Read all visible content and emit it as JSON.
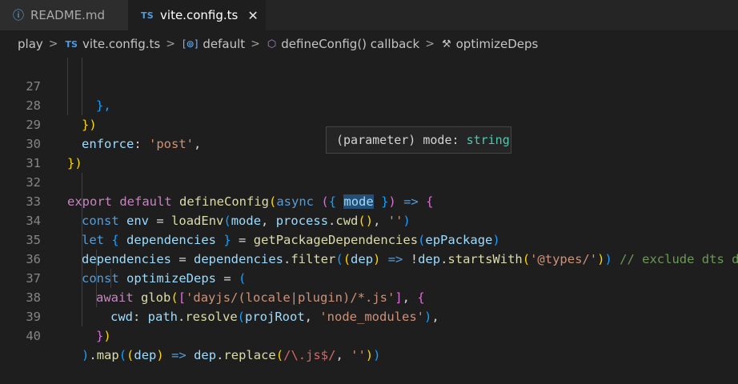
{
  "tabs": [
    {
      "label": "README.md",
      "icon": "info-icon",
      "active": false
    },
    {
      "label": "vite.config.ts",
      "icon": "typescript-icon",
      "icon_text": "TS",
      "active": true,
      "close_glyph": "✕"
    }
  ],
  "breadcrumb": {
    "items": [
      {
        "label": "play",
        "icon": ""
      },
      {
        "label": "vite.config.ts",
        "icon": "typescript-icon",
        "icon_text": "TS"
      },
      {
        "label": "default",
        "icon": "variable-icon",
        "icon_text": "[⊚]"
      },
      {
        "label": "defineConfig() callback",
        "icon": "method-cube-icon",
        "icon_text": "⬡"
      },
      {
        "label": "optimizeDeps",
        "icon": "wrench-icon",
        "icon_text": "🔧"
      }
    ],
    "separator": ">"
  },
  "hover": {
    "prefix": "(parameter) mode: ",
    "type": "string"
  },
  "lines": [
    {
      "n": "27"
    },
    {
      "n": "28"
    },
    {
      "n": "29"
    },
    {
      "n": "30"
    },
    {
      "n": "31"
    },
    {
      "n": "32"
    },
    {
      "n": "33"
    },
    {
      "n": "34"
    },
    {
      "n": "35"
    },
    {
      "n": "36"
    },
    {
      "n": "37"
    },
    {
      "n": "38"
    },
    {
      "n": "39"
    },
    {
      "n": "40"
    }
  ],
  "code": {
    "l27": [
      "},",
      ","
    ],
    "l28": [
      "})",
      ","
    ],
    "l29": {
      "key": "enforce",
      "colon": ": ",
      "val": "'post'",
      "end": ","
    },
    "l30": "})",
    "l32": {
      "kw1": "export",
      "kw2": "default",
      "fn": "defineConfig",
      "p1": "(",
      "async": "async",
      "p2": "(",
      "b": "{",
      "param": "mode",
      "b2": "}",
      "p3": ")",
      "arrow": "=>",
      "brace": "{"
    },
    "l33": {
      "kw": "const",
      "v": "env",
      "eq": "=",
      "fn": "loadEnv",
      "p1": "(",
      "a1": "mode",
      "c": ", ",
      "a2": "process",
      "dot": ".",
      "fn2": "cwd",
      "p2": "()",
      "c2": ", ",
      "s": "''",
      "p3": ")"
    },
    "l34": {
      "kw": "let",
      "b1": "{",
      "v": "dependencies",
      "b2": "}",
      "eq": "=",
      "fn": "getPackageDependencies",
      "p1": "(",
      "a": "epPackage",
      "p2": ")"
    },
    "l35": {
      "v": "dependencies",
      "eq": "=",
      "v2": "dependencies",
      "dot": ".",
      "fn": "filter",
      "p1": "(",
      "p2": "(",
      "a": "dep",
      "p3": ")",
      "arrow": "=>",
      "not": "!",
      "v3": "dep",
      "dot2": ".",
      "fn2": "startsWith",
      "p4": "(",
      "s": "'@types/'",
      "p5": ")",
      "p6": ")",
      "cm": "// exclude dts deps"
    },
    "l36": {
      "kw": "const",
      "v": "optimizeDeps",
      "eq": "=",
      "p": "("
    },
    "l37": {
      "kw": "await",
      "fn": "glob",
      "p1": "(",
      "b1": "[",
      "s": "'dayjs/(locale|plugin)/*.js'",
      "b2": "]",
      "c": ", ",
      "b3": "{"
    },
    "l38": {
      "key": "cwd",
      "colon": ": ",
      "v": "path",
      "dot": ".",
      "fn": "resolve",
      "p1": "(",
      "a": "projRoot",
      "c": ", ",
      "s": "'node_modules'",
      "p2": ")",
      "end": ","
    },
    "l39": {
      "b": "}",
      "p": ")"
    },
    "l40": {
      "p": ")",
      "dot": ".",
      "fn": "map",
      "p1": "(",
      "p2": "(",
      "a": "dep",
      "p3": ")",
      "arrow": "=>",
      "v": "dep",
      "dot2": ".",
      "fn2": "replace",
      "p4": "(",
      "rx1": "/",
      "rx2": "\\.js$",
      "rx3": "/",
      "c": ", ",
      "s": "''",
      "p5": ")",
      "p6": ")"
    }
  },
  "colors": {
    "background": "#1e1e1e",
    "keyword": "#569cd6",
    "control": "#c586c0",
    "function": "#dcdcaa",
    "variable": "#9cdcfe",
    "string": "#ce9178",
    "comment": "#6a9955",
    "type": "#4ec9b0"
  }
}
